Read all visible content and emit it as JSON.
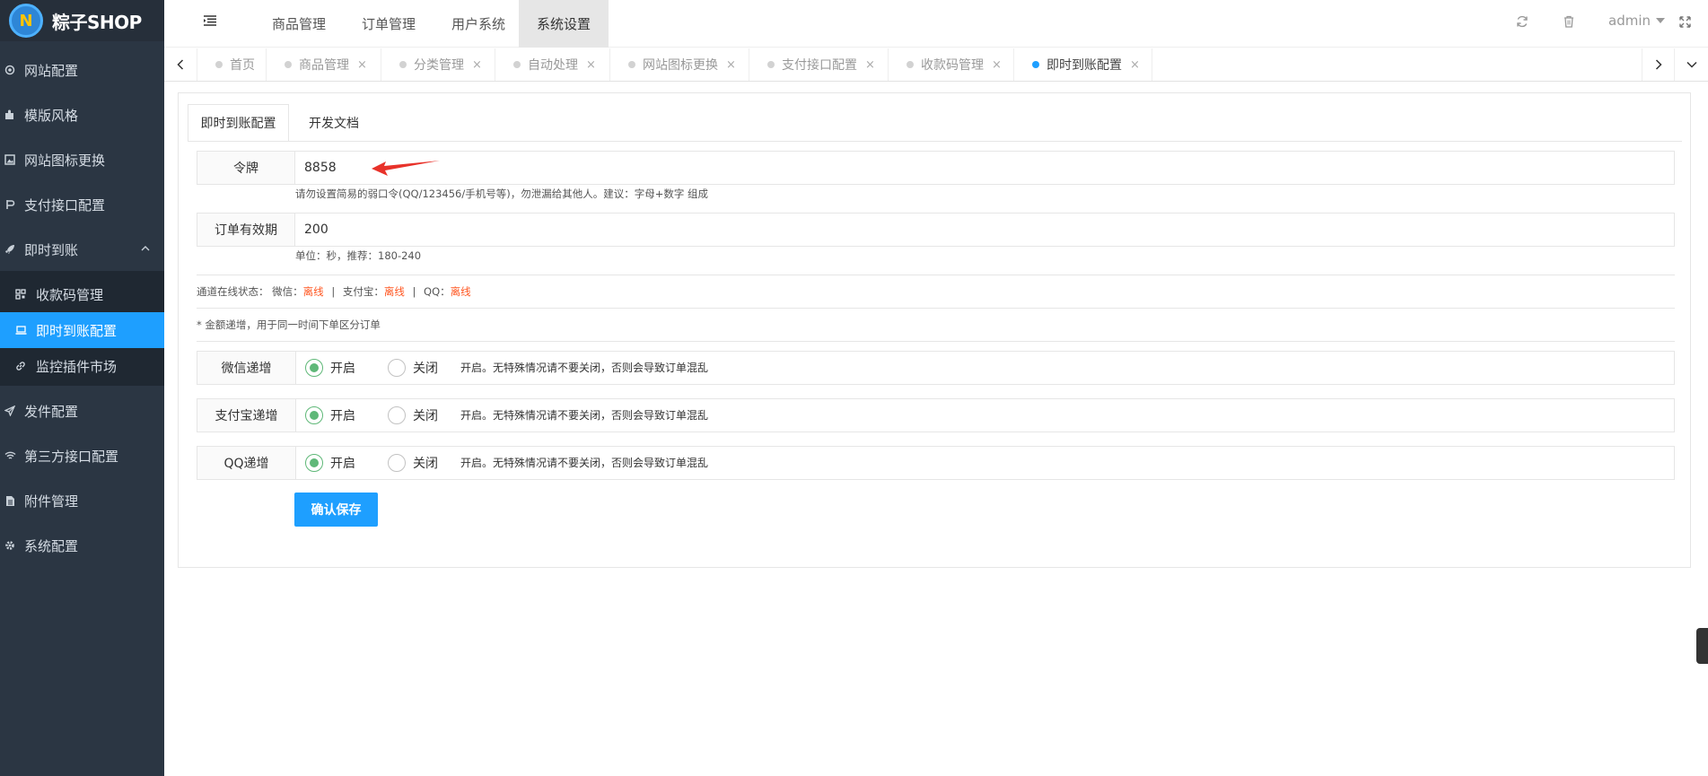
{
  "brand": {
    "logo_letter": "N",
    "name": "粽子SHOP"
  },
  "sidebar": {
    "items": [
      {
        "label": "网站配置",
        "icon": "circle-dot-icon"
      },
      {
        "label": "模版风格",
        "icon": "puzzle-icon"
      },
      {
        "label": "网站图标更换",
        "icon": "image-icon"
      },
      {
        "label": "支付接口配置",
        "icon": "payment-icon"
      },
      {
        "label": "即时到账",
        "icon": "rocket-icon"
      },
      {
        "label": "发件配置",
        "icon": "send-icon"
      },
      {
        "label": "第三方接口配置",
        "icon": "wifi-icon"
      },
      {
        "label": "附件管理",
        "icon": "file-icon"
      },
      {
        "label": "系统配置",
        "icon": "gear-icon"
      }
    ],
    "sub_items": [
      {
        "label": "收款码管理",
        "icon": "qrcode-icon"
      },
      {
        "label": "即时到账配置",
        "icon": "laptop-icon"
      },
      {
        "label": "监控插件市场",
        "icon": "link-icon"
      }
    ]
  },
  "topbar": {
    "menu_icon": "menu-icon",
    "nav": [
      "商品管理",
      "订单管理",
      "用户系统",
      "系统设置"
    ],
    "active_nav": "系统设置",
    "user": "admin"
  },
  "tabs": {
    "items": [
      "首页",
      "商品管理",
      "分类管理",
      "自动处理",
      "网站图标更换",
      "支付接口配置",
      "收款码管理",
      "即时到账配置"
    ],
    "active": "即时到账配置",
    "close_glyph": "×"
  },
  "form": {
    "tabs": [
      "即时到账配置",
      "开发文档"
    ],
    "token": {
      "label": "令牌",
      "value": "8858",
      "hint": "请勿设置简易的弱口令(QQ/123456/手机号等)，勿泄漏给其他人。建议：字母+数字 组成"
    },
    "expiry": {
      "label": "订单有效期",
      "value": "200",
      "hint": "单位：秒，推荐：180-240"
    },
    "status": {
      "prefix": "通道在线状态：",
      "wechat_label": "微信：",
      "wechat": "离线",
      "sep": "|",
      "alipay_label": "支付宝：",
      "alipay": "离线",
      "qq_label": "QQ：",
      "qq": "离线"
    },
    "amount_note": "* 金额递增，用于同一时间下单区分订单",
    "increments": [
      {
        "label": "微信递增",
        "on": "开启",
        "off": "关闭",
        "selected": "开启",
        "note": "开启。无特殊情况请不要关闭，否则会导致订单混乱"
      },
      {
        "label": "支付宝递增",
        "on": "开启",
        "off": "关闭",
        "selected": "开启",
        "note": "开启。无特殊情况请不要关闭，否则会导致订单混乱"
      },
      {
        "label": "QQ递增",
        "on": "开启",
        "off": "关闭",
        "selected": "开启",
        "note": "开启。无特殊情况请不要关闭，否则会导致订单混乱"
      }
    ],
    "save_label": "确认保存"
  },
  "colors": {
    "accent": "#1e9fff",
    "sidebar": "#2b3643",
    "offline": "#ff5722",
    "radio_on": "#5fb878"
  }
}
